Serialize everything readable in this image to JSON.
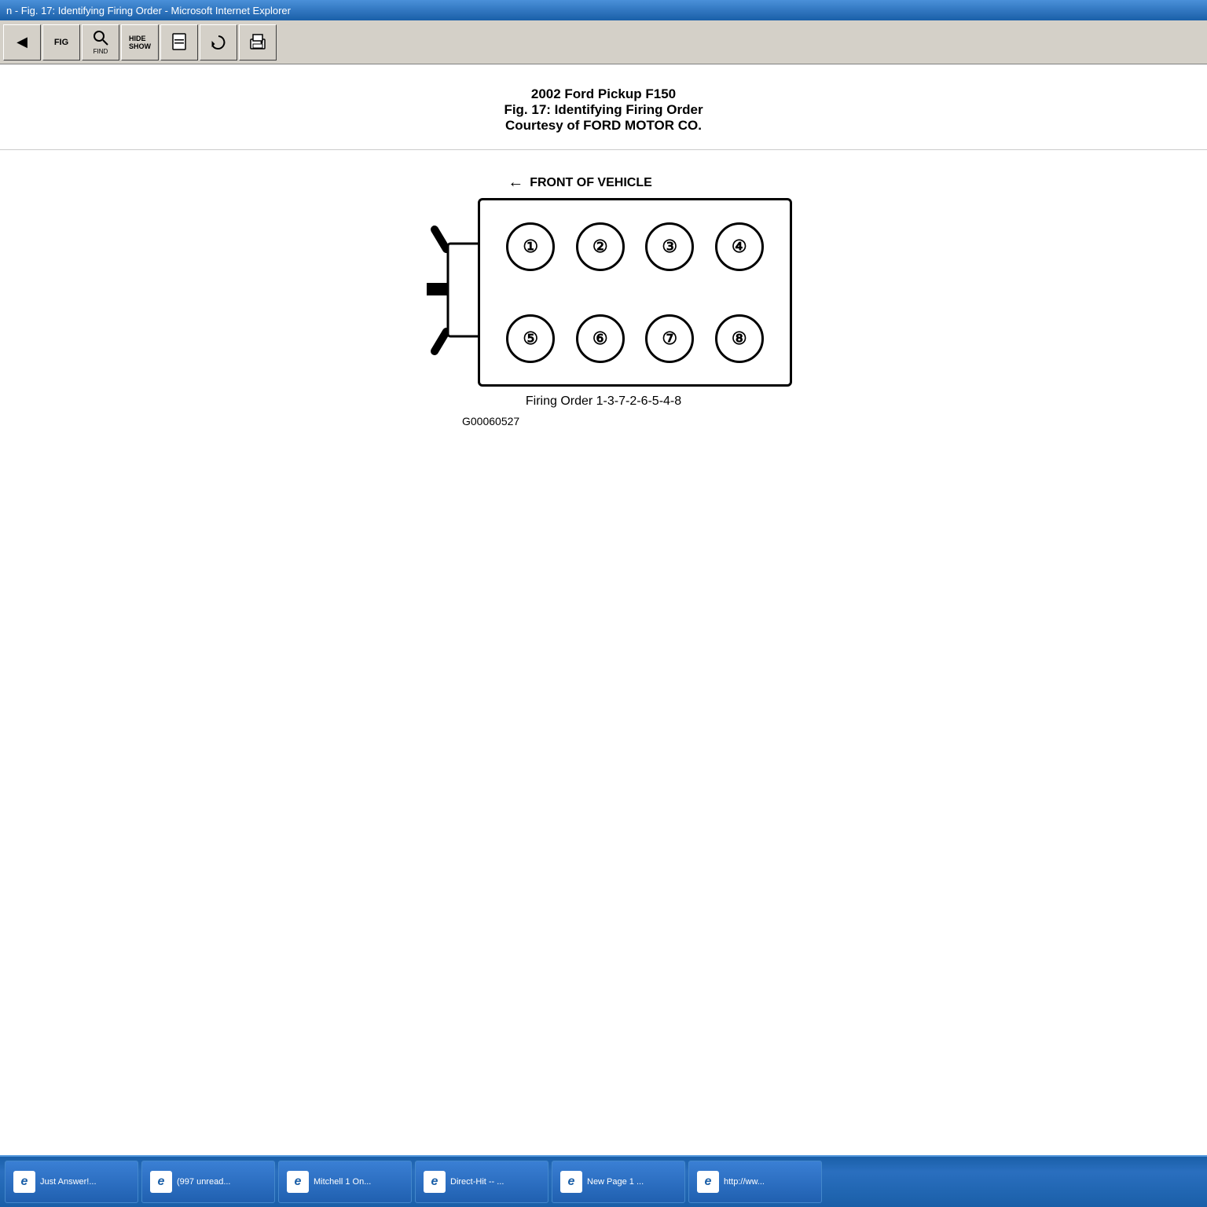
{
  "titlebar": {
    "text": "n - Fig. 17: Identifying Firing Order - Microsoft Internet Explorer"
  },
  "toolbar": {
    "buttons": [
      {
        "name": "prev-fig",
        "label": "",
        "icon": "◀"
      },
      {
        "name": "next-fig",
        "label": "FIG",
        "icon": "FIG"
      },
      {
        "name": "find",
        "label": "FIND",
        "icon": "🔍"
      },
      {
        "name": "hide-show",
        "label": "HIDE SHOW",
        "icon": ""
      },
      {
        "name": "bookmark",
        "label": "",
        "icon": "📄"
      },
      {
        "name": "refresh",
        "label": "",
        "icon": "↻"
      },
      {
        "name": "print",
        "label": "",
        "icon": "🖨"
      }
    ]
  },
  "header": {
    "line1": "2002 Ford Pickup F150",
    "line2": "Fig. 17: Identifying Firing Order",
    "line3": "Courtesy of FORD MOTOR CO."
  },
  "diagram": {
    "front_label": "FRONT OF VEHICLE",
    "cylinders_top": [
      "①",
      "②",
      "③",
      "④"
    ],
    "cylinders_bottom": [
      "⑤",
      "⑥",
      "⑦",
      "⑧"
    ],
    "firing_order_label": "Firing Order 1-3-7-2-6-5-4-8",
    "part_number": "G00060527"
  },
  "taskbar": {
    "buttons": [
      {
        "id": "btn-justanswer",
        "text": "Just Answer!..."
      },
      {
        "id": "btn-997unread",
        "text": "(997 unread..."
      },
      {
        "id": "btn-mitchell",
        "text": "Mitchell 1 On..."
      },
      {
        "id": "btn-directhit",
        "text": "Direct-Hit -- ..."
      },
      {
        "id": "btn-newpage1",
        "text": "New Page 1 ..."
      },
      {
        "id": "btn-http",
        "text": "http://ww..."
      }
    ]
  }
}
